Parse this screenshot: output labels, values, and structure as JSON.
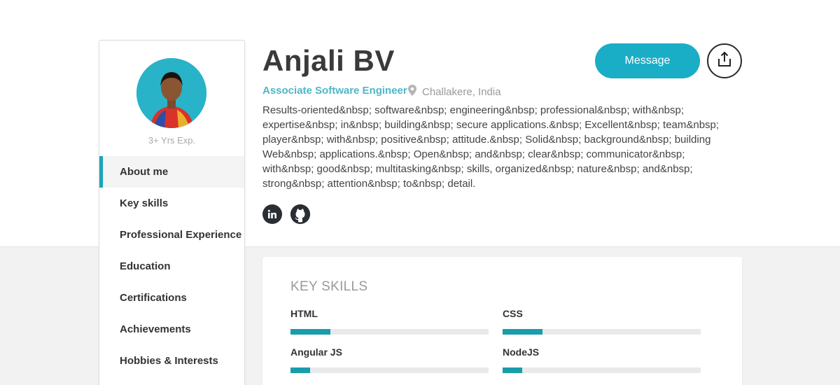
{
  "profile": {
    "name": "Anjali BV",
    "role": "Associate Software Engineer",
    "location": "Challakere, India",
    "experience": "3+ Yrs Exp.",
    "summary": "Results-oriented&nbsp; software&nbsp; engineering&nbsp; professional&nbsp; with&nbsp; expertise&nbsp; in&nbsp; building&nbsp; secure applications.&nbsp; Excellent&nbsp; team&nbsp; player&nbsp; with&nbsp; positive&nbsp; attitude.&nbsp; Solid&nbsp; background&nbsp; building Web&nbsp; applications.&nbsp; Open&nbsp; and&nbsp; clear&nbsp; communicator&nbsp; with&nbsp; good&nbsp; multitasking&nbsp; skills, organized&nbsp; nature&nbsp; and&nbsp; strong&nbsp; attention&nbsp; to&nbsp; detail."
  },
  "actions": {
    "message_label": "Message"
  },
  "social": [
    {
      "icon": "linkedin-icon"
    },
    {
      "icon": "github-icon"
    }
  ],
  "nav": {
    "items": [
      {
        "label": "About me",
        "active": true
      },
      {
        "label": "Key skills"
      },
      {
        "label": "Professional Experience"
      },
      {
        "label": "Education"
      },
      {
        "label": "Certifications"
      },
      {
        "label": "Achievements"
      },
      {
        "label": "Hobbies & Interests"
      }
    ]
  },
  "skills": {
    "title": "KEY SKILLS",
    "items": [
      {
        "name": "HTML",
        "level": 0.2
      },
      {
        "name": "CSS",
        "level": 0.2
      },
      {
        "name": "Angular JS",
        "level": 0.1
      },
      {
        "name": "NodeJS",
        "level": 0.1
      }
    ]
  },
  "colors": {
    "accent": "#1aaec6",
    "bar_fill": "#1a9cab",
    "role_text": "#4fb6c7"
  }
}
